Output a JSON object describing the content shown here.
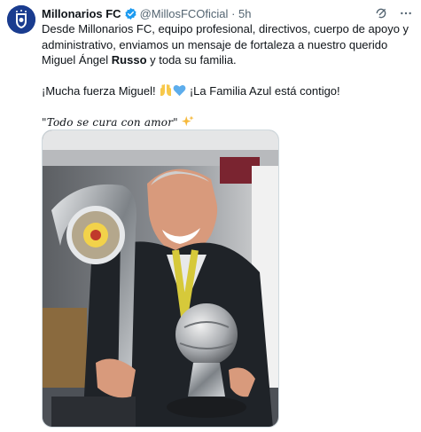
{
  "tweet": {
    "display_name": "Millonarios FC",
    "handle": "@MillosFCOficial",
    "separator": "·",
    "time": "5h",
    "body_1a": "Desde Millonarios FC, equipo profesional, directivos, cuerpo de apoyo y administrativo, enviamos un mensaje de fortaleza a nuestro querido Miguel Ángel ",
    "body_1_bold": "Russo",
    "body_1b": " y toda su familia.",
    "body_2a": "¡Mucha fuerza Miguel! ",
    "body_2b": " ¡La Familia Azul está contigo!",
    "body_3": "\"Todo se cura con amor\"",
    "icons": {
      "avatar": "millonarios-crest-icon",
      "verified": "verified-badge-icon",
      "grok": "grok-icon",
      "more": "more-icon",
      "emoji_hands": "raised-hands-emoji",
      "emoji_heart": "blue-heart-emoji",
      "emoji_sparkles": "sparkles-emoji"
    },
    "colors": {
      "brand_blue": "#1a3c8f",
      "verified_blue": "#1d9bf0",
      "muted": "#536471"
    }
  }
}
